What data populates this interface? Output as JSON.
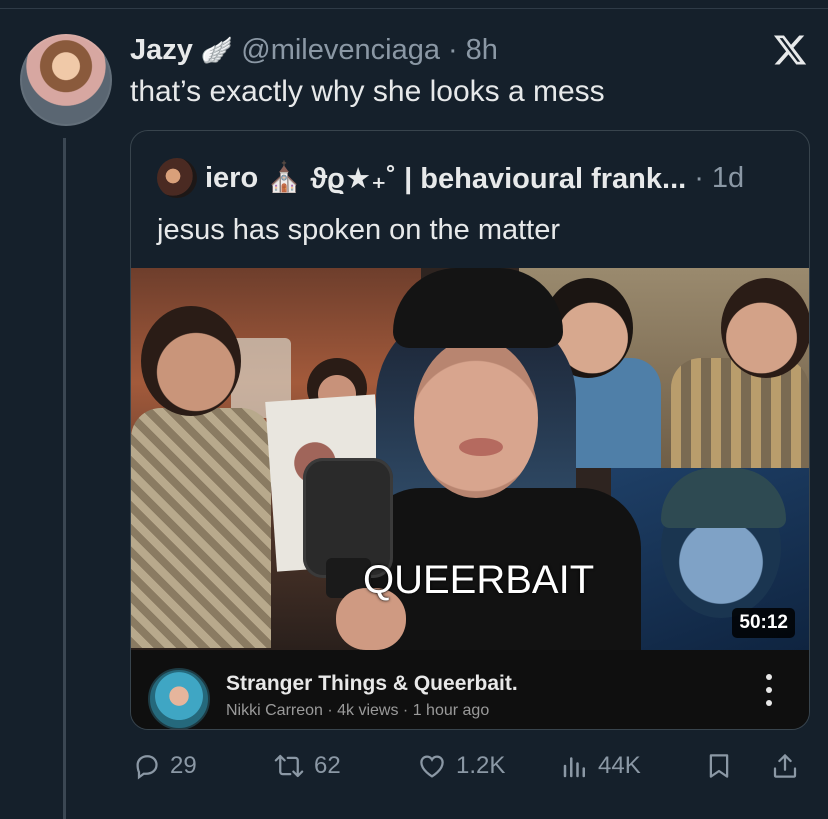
{
  "tweet": {
    "author_name": "Jazy",
    "badge_emoji": "🪽",
    "handle": "@milevenciaga",
    "separator": "·",
    "time": "8h",
    "text": "that’s exactly why she looks a mess"
  },
  "quote": {
    "author_name": "iero",
    "emoji": "⛪",
    "name_suffix": "ϑϱ★₊˚ | behavioural frank...",
    "separator": "·",
    "time": "1d",
    "text": "jesus has spoken on the matter",
    "media": {
      "overlay_text": "QUEERBAIT",
      "duration": "50:12"
    },
    "youtube": {
      "title": "Stranger Things & Queerbait.",
      "subtitle": "Nikki Carreon · 4k views · 1 hour ago"
    }
  },
  "actions": {
    "replies": "29",
    "reposts": "62",
    "likes": "1.2K",
    "views": "44K"
  },
  "icons": [
    "x-logo-icon",
    "reply-icon",
    "repost-icon",
    "like-icon",
    "views-icon",
    "bookmark-icon",
    "share-icon",
    "more-vertical-icon"
  ]
}
